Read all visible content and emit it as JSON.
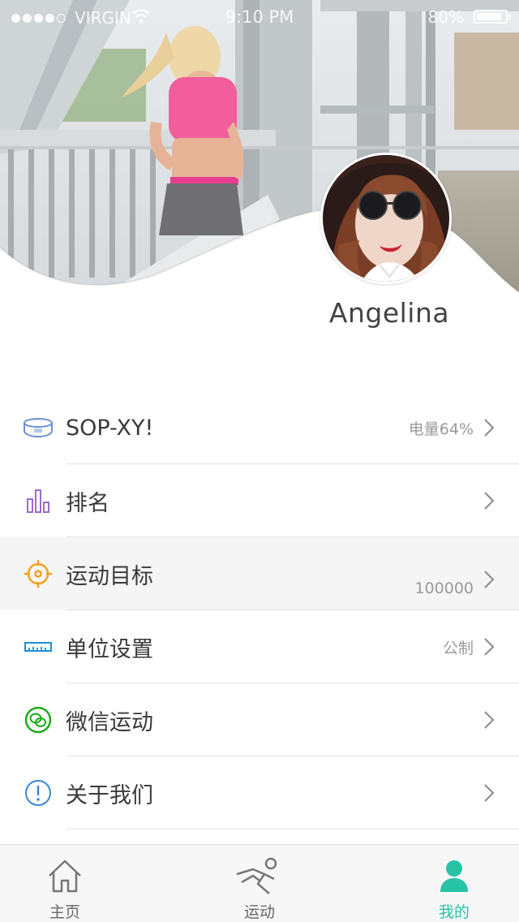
{
  "status_bar": {
    "carrier": "VIRGIN",
    "time": "9:10 PM",
    "battery": "80%"
  },
  "profile": {
    "name": "Angelina"
  },
  "menu": [
    {
      "label": "SOP-XY!",
      "value": "电量64%",
      "icon": "wristband-icon"
    },
    {
      "label": "排名",
      "value": "",
      "icon": "bar-chart-icon"
    },
    {
      "label": "运动目标",
      "value": "100000",
      "icon": "target-icon"
    },
    {
      "label": "单位设置",
      "value": "公制",
      "icon": "ruler-icon"
    },
    {
      "label": "微信运动",
      "value": "",
      "icon": "wechat-icon"
    },
    {
      "label": "关于我们",
      "value": "",
      "icon": "info-icon"
    }
  ],
  "tabbar": {
    "home": "主页",
    "sport": "运动",
    "mine": "我的"
  },
  "colors": {
    "accent": "#27c3a5",
    "icon_wristband": "#6b8fd6",
    "icon_ranking": "#9b6ad1",
    "icon_target": "#f0a020",
    "icon_ruler": "#1e8fd0",
    "icon_wechat": "#1aad19",
    "icon_info": "#3a86d8"
  }
}
